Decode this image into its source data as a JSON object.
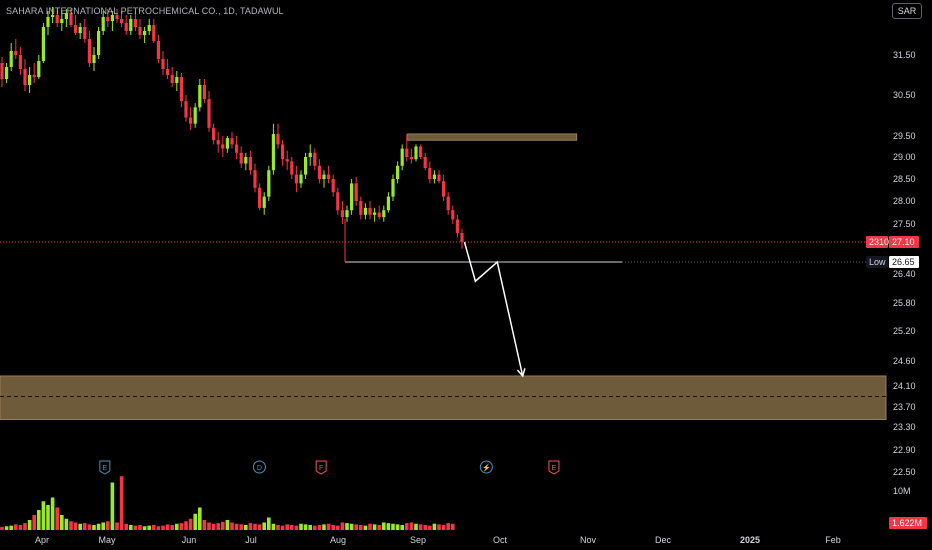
{
  "header": {
    "symbol_title": "SAHARA INTERNATIONAL PETROCHEMICAL CO., 1D, TADAWUL",
    "currency_button": "SAR"
  },
  "colors": {
    "background": "#000000",
    "up": "#9be82a",
    "down": "#f23645",
    "zone": "#7a6540",
    "current_price_badge": "#f23645",
    "low_badge": "#131722"
  },
  "price_badges": {
    "current_label": "2310",
    "current_value": "27.10",
    "low_label": "Low",
    "low_value": "26.65"
  },
  "volume_badges": {
    "scale_label": "10M",
    "current_value": "1.622M"
  },
  "event_markers": [
    {
      "icon": "earnings-icon",
      "letter": "E",
      "date": "2024-04-30",
      "color": "#4a8fb5"
    },
    {
      "icon": "dividend-icon",
      "letter": "D",
      "date": "2024-07-04",
      "color": "#4a8fb5"
    },
    {
      "icon": "financials-icon",
      "letter": "F",
      "date": "2024-07-26",
      "color": "#f7525f"
    },
    {
      "icon": "split-icon",
      "letter": "⚡",
      "date": "2024-09-26",
      "color": "#4a8fb5"
    },
    {
      "icon": "earnings-icon",
      "letter": "E",
      "date": "2024-10-20",
      "color": "#f7525f"
    }
  ],
  "chart_data": {
    "type": "candlestick",
    "title": "SAHARA INTERNATIONAL PETROCHEMICAL CO., 1D, TADAWUL",
    "currency": "SAR",
    "y_axis": {
      "ticks": [
        31.5,
        30.5,
        29.5,
        29.0,
        28.5,
        28.0,
        27.5,
        26.4,
        25.8,
        25.2,
        24.6,
        24.1,
        23.7,
        23.3,
        22.9,
        22.5
      ],
      "tick_labels": [
        "31.50",
        "30.50",
        "29.50",
        "29.00",
        "28.50",
        "28.00",
        "27.50",
        "26.40",
        "25.80",
        "25.20",
        "24.60",
        "24.10",
        "23.70",
        "23.30",
        "22.90",
        "22.50"
      ]
    },
    "x_axis": {
      "tick_labels": [
        {
          "label": "Apr",
          "date": "2024-04-01"
        },
        {
          "label": "May",
          "date": "2024-05-01"
        },
        {
          "label": "Jun",
          "date": "2024-06-01"
        },
        {
          "label": "Jul",
          "date": "2024-07-01"
        },
        {
          "label": "Aug",
          "date": "2024-08-01"
        },
        {
          "label": "Sep",
          "date": "2024-09-01"
        },
        {
          "label": "Oct",
          "date": "2024-10-01"
        },
        {
          "label": "Nov",
          "date": "2024-11-01"
        },
        {
          "label": "Dec",
          "date": "2024-12-01"
        },
        {
          "label": "2025",
          "date": "2025-01-01",
          "bold": true
        },
        {
          "label": "Feb",
          "date": "2025-02-01"
        }
      ]
    },
    "last_price": 27.1,
    "low_level": 26.65,
    "zones": [
      {
        "name": "resistance",
        "price_low": 29.4,
        "price_high": 29.55,
        "date_start": "2024-08-28",
        "date_end": "2024-10-28"
      },
      {
        "name": "target",
        "price_low": 23.45,
        "price_high": 24.3,
        "date_start": "2024-03-01",
        "date_end": "2025-02-28",
        "midline": 23.9
      }
    ],
    "projection_path": [
      {
        "date": "2024-09-18",
        "price": 27.1
      },
      {
        "date": "2024-09-22",
        "price": 26.25
      },
      {
        "date": "2024-09-30",
        "price": 26.65
      },
      {
        "date": "2024-10-09",
        "price": 24.3
      }
    ],
    "candles": [
      {
        "o": 31.3,
        "h": 31.45,
        "l": 30.7,
        "c": 30.9
      },
      {
        "o": 30.9,
        "h": 31.3,
        "l": 30.8,
        "c": 31.2
      },
      {
        "o": 31.2,
        "h": 31.8,
        "l": 31.1,
        "c": 31.6
      },
      {
        "o": 31.6,
        "h": 31.9,
        "l": 31.4,
        "c": 31.5
      },
      {
        "o": 31.5,
        "h": 31.7,
        "l": 31.0,
        "c": 31.15
      },
      {
        "o": 31.15,
        "h": 31.4,
        "l": 30.6,
        "c": 30.75
      },
      {
        "o": 30.75,
        "h": 31.2,
        "l": 30.55,
        "c": 31.0
      },
      {
        "o": 31.0,
        "h": 31.3,
        "l": 30.8,
        "c": 30.95
      },
      {
        "o": 30.95,
        "h": 31.5,
        "l": 30.9,
        "c": 31.35
      },
      {
        "o": 31.35,
        "h": 32.3,
        "l": 31.3,
        "c": 32.2
      },
      {
        "o": 32.2,
        "h": 32.6,
        "l": 32.0,
        "c": 32.45
      },
      {
        "o": 32.45,
        "h": 32.7,
        "l": 32.3,
        "c": 32.5
      },
      {
        "o": 32.5,
        "h": 32.65,
        "l": 32.2,
        "c": 32.3
      },
      {
        "o": 32.3,
        "h": 32.6,
        "l": 32.1,
        "c": 32.4
      },
      {
        "o": 32.4,
        "h": 32.65,
        "l": 32.2,
        "c": 32.55
      },
      {
        "o": 32.55,
        "h": 32.65,
        "l": 32.2,
        "c": 32.25
      },
      {
        "o": 32.25,
        "h": 32.5,
        "l": 32.0,
        "c": 32.05
      },
      {
        "o": 32.05,
        "h": 32.3,
        "l": 31.9,
        "c": 32.2
      },
      {
        "o": 32.2,
        "h": 32.4,
        "l": 31.8,
        "c": 31.9
      },
      {
        "o": 31.9,
        "h": 32.1,
        "l": 31.2,
        "c": 31.3
      },
      {
        "o": 31.3,
        "h": 31.7,
        "l": 31.1,
        "c": 31.5
      },
      {
        "o": 31.5,
        "h": 32.2,
        "l": 31.4,
        "c": 32.1
      },
      {
        "o": 32.1,
        "h": 32.6,
        "l": 32.0,
        "c": 32.45
      },
      {
        "o": 32.45,
        "h": 32.65,
        "l": 32.2,
        "c": 32.35
      },
      {
        "o": 32.35,
        "h": 32.6,
        "l": 32.1,
        "c": 32.5
      },
      {
        "o": 32.5,
        "h": 32.65,
        "l": 32.3,
        "c": 32.4
      },
      {
        "o": 32.4,
        "h": 32.6,
        "l": 32.2,
        "c": 32.3
      },
      {
        "o": 32.3,
        "h": 32.5,
        "l": 32.0,
        "c": 32.1
      },
      {
        "o": 32.1,
        "h": 32.5,
        "l": 32.0,
        "c": 32.4
      },
      {
        "o": 32.4,
        "h": 32.6,
        "l": 32.1,
        "c": 32.2
      },
      {
        "o": 32.2,
        "h": 32.4,
        "l": 31.9,
        "c": 32.0
      },
      {
        "o": 32.0,
        "h": 32.2,
        "l": 31.8,
        "c": 32.1
      },
      {
        "o": 32.1,
        "h": 32.4,
        "l": 32.0,
        "c": 32.25
      },
      {
        "o": 32.25,
        "h": 32.4,
        "l": 31.8,
        "c": 31.85
      },
      {
        "o": 31.85,
        "h": 32.0,
        "l": 31.3,
        "c": 31.4
      },
      {
        "o": 31.4,
        "h": 31.6,
        "l": 31.0,
        "c": 31.15
      },
      {
        "o": 31.15,
        "h": 31.4,
        "l": 30.9,
        "c": 31.0
      },
      {
        "o": 31.0,
        "h": 31.2,
        "l": 30.7,
        "c": 30.8
      },
      {
        "o": 30.8,
        "h": 31.1,
        "l": 30.6,
        "c": 30.95
      },
      {
        "o": 30.95,
        "h": 31.05,
        "l": 30.2,
        "c": 30.35
      },
      {
        "o": 30.35,
        "h": 30.5,
        "l": 29.85,
        "c": 29.95
      },
      {
        "o": 29.95,
        "h": 30.2,
        "l": 29.65,
        "c": 29.8
      },
      {
        "o": 29.8,
        "h": 30.3,
        "l": 29.7,
        "c": 30.2
      },
      {
        "o": 30.2,
        "h": 30.9,
        "l": 30.1,
        "c": 30.75
      },
      {
        "o": 30.75,
        "h": 30.9,
        "l": 30.3,
        "c": 30.4
      },
      {
        "o": 30.4,
        "h": 30.6,
        "l": 29.6,
        "c": 29.7
      },
      {
        "o": 29.7,
        "h": 29.8,
        "l": 29.3,
        "c": 29.4
      },
      {
        "o": 29.4,
        "h": 29.6,
        "l": 29.1,
        "c": 29.3
      },
      {
        "o": 29.3,
        "h": 29.5,
        "l": 29.0,
        "c": 29.2
      },
      {
        "o": 29.2,
        "h": 29.5,
        "l": 29.1,
        "c": 29.45
      },
      {
        "o": 29.45,
        "h": 29.6,
        "l": 29.2,
        "c": 29.3
      },
      {
        "o": 29.3,
        "h": 29.5,
        "l": 28.95,
        "c": 29.1
      },
      {
        "o": 29.1,
        "h": 29.25,
        "l": 28.75,
        "c": 28.85
      },
      {
        "o": 28.85,
        "h": 29.1,
        "l": 28.7,
        "c": 29.0
      },
      {
        "o": 29.0,
        "h": 29.15,
        "l": 28.6,
        "c": 28.7
      },
      {
        "o": 28.7,
        "h": 28.85,
        "l": 28.2,
        "c": 28.3
      },
      {
        "o": 28.3,
        "h": 28.4,
        "l": 27.8,
        "c": 27.85
      },
      {
        "o": 27.85,
        "h": 28.2,
        "l": 27.7,
        "c": 28.1
      },
      {
        "o": 28.1,
        "h": 28.8,
        "l": 28.0,
        "c": 28.7
      },
      {
        "o": 28.7,
        "h": 29.8,
        "l": 28.6,
        "c": 29.55
      },
      {
        "o": 29.55,
        "h": 29.8,
        "l": 29.2,
        "c": 29.3
      },
      {
        "o": 29.3,
        "h": 29.4,
        "l": 28.8,
        "c": 28.95
      },
      {
        "o": 28.95,
        "h": 29.15,
        "l": 28.7,
        "c": 28.9
      },
      {
        "o": 28.9,
        "h": 29.0,
        "l": 28.5,
        "c": 28.6
      },
      {
        "o": 28.6,
        "h": 28.8,
        "l": 28.2,
        "c": 28.4
      },
      {
        "o": 28.4,
        "h": 28.7,
        "l": 28.3,
        "c": 28.6
      },
      {
        "o": 28.6,
        "h": 29.1,
        "l": 28.5,
        "c": 29.0
      },
      {
        "o": 29.0,
        "h": 29.3,
        "l": 28.8,
        "c": 29.1
      },
      {
        "o": 29.1,
        "h": 29.2,
        "l": 28.7,
        "c": 28.8
      },
      {
        "o": 28.8,
        "h": 28.95,
        "l": 28.4,
        "c": 28.5
      },
      {
        "o": 28.5,
        "h": 28.7,
        "l": 28.3,
        "c": 28.6
      },
      {
        "o": 28.6,
        "h": 28.8,
        "l": 28.4,
        "c": 28.5
      },
      {
        "o": 28.5,
        "h": 28.6,
        "l": 28.1,
        "c": 28.2
      },
      {
        "o": 28.2,
        "h": 28.3,
        "l": 27.7,
        "c": 27.8
      },
      {
        "o": 27.8,
        "h": 28.0,
        "l": 27.5,
        "c": 27.65
      },
      {
        "o": 27.65,
        "h": 27.9,
        "l": 27.55,
        "c": 27.8
      },
      {
        "o": 27.8,
        "h": 28.5,
        "l": 27.7,
        "c": 28.4
      },
      {
        "o": 28.4,
        "h": 28.55,
        "l": 27.9,
        "c": 28.0
      },
      {
        "o": 28.0,
        "h": 28.1,
        "l": 27.6,
        "c": 27.7
      },
      {
        "o": 27.7,
        "h": 27.95,
        "l": 27.6,
        "c": 27.85
      },
      {
        "o": 27.85,
        "h": 28.0,
        "l": 27.6,
        "c": 27.7
      },
      {
        "o": 27.7,
        "h": 27.85,
        "l": 27.55,
        "c": 27.75
      },
      {
        "o": 27.75,
        "h": 27.9,
        "l": 27.6,
        "c": 27.65
      },
      {
        "o": 27.65,
        "h": 27.9,
        "l": 27.55,
        "c": 27.8
      },
      {
        "o": 27.8,
        "h": 28.2,
        "l": 27.75,
        "c": 28.1
      },
      {
        "o": 28.1,
        "h": 28.6,
        "l": 28.0,
        "c": 28.5
      },
      {
        "o": 28.5,
        "h": 28.9,
        "l": 28.4,
        "c": 28.8
      },
      {
        "o": 28.8,
        "h": 29.3,
        "l": 28.7,
        "c": 29.2
      },
      {
        "o": 29.2,
        "h": 29.55,
        "l": 28.9,
        "c": 29.0
      },
      {
        "o": 29.0,
        "h": 29.2,
        "l": 28.85,
        "c": 28.95
      },
      {
        "o": 28.95,
        "h": 29.3,
        "l": 28.9,
        "c": 29.25
      },
      {
        "o": 29.25,
        "h": 29.3,
        "l": 28.95,
        "c": 29.0
      },
      {
        "o": 29.0,
        "h": 29.1,
        "l": 28.7,
        "c": 28.75
      },
      {
        "o": 28.75,
        "h": 28.9,
        "l": 28.4,
        "c": 28.5
      },
      {
        "o": 28.5,
        "h": 28.7,
        "l": 28.4,
        "c": 28.6
      },
      {
        "o": 28.6,
        "h": 28.7,
        "l": 28.4,
        "c": 28.45
      },
      {
        "o": 28.45,
        "h": 28.6,
        "l": 28.0,
        "c": 28.1
      },
      {
        "o": 28.1,
        "h": 28.2,
        "l": 27.7,
        "c": 27.8
      },
      {
        "o": 27.8,
        "h": 27.9,
        "l": 27.5,
        "c": 27.6
      },
      {
        "o": 27.6,
        "h": 27.7,
        "l": 27.2,
        "c": 27.3
      },
      {
        "o": 27.3,
        "h": 27.4,
        "l": 26.95,
        "c": 27.1
      }
    ],
    "volume": [
      0.25,
      0.3,
      0.35,
      0.45,
      0.4,
      0.55,
      0.8,
      1.2,
      1.6,
      2.3,
      2.0,
      2.6,
      1.8,
      1.2,
      0.9,
      0.7,
      0.6,
      0.5,
      0.55,
      0.45,
      0.4,
      0.5,
      0.6,
      0.7,
      3.8,
      0.6,
      4.3,
      0.5,
      0.4,
      0.35,
      0.4,
      0.3,
      0.35,
      0.4,
      0.3,
      0.35,
      0.45,
      0.4,
      0.5,
      0.55,
      0.7,
      0.9,
      1.3,
      1.8,
      0.8,
      0.6,
      0.5,
      0.55,
      0.65,
      0.8,
      0.6,
      0.5,
      0.45,
      0.4,
      0.55,
      0.5,
      0.45,
      0.6,
      1.0,
      0.5,
      0.4,
      0.35,
      0.45,
      0.4,
      0.35,
      0.5,
      0.45,
      0.4,
      0.35,
      0.4,
      0.45,
      0.5,
      0.4,
      0.35,
      0.6,
      0.55,
      0.5,
      0.45,
      0.4,
      0.35,
      0.5,
      0.45,
      0.4,
      0.6,
      0.55,
      0.5,
      0.45,
      0.4,
      0.55,
      0.6,
      0.5,
      0.45,
      0.4,
      0.35,
      0.5,
      0.45,
      0.4,
      0.55,
      0.5
    ],
    "volume_axis": {
      "max_label": "10M",
      "last_label": "1.622M"
    }
  }
}
